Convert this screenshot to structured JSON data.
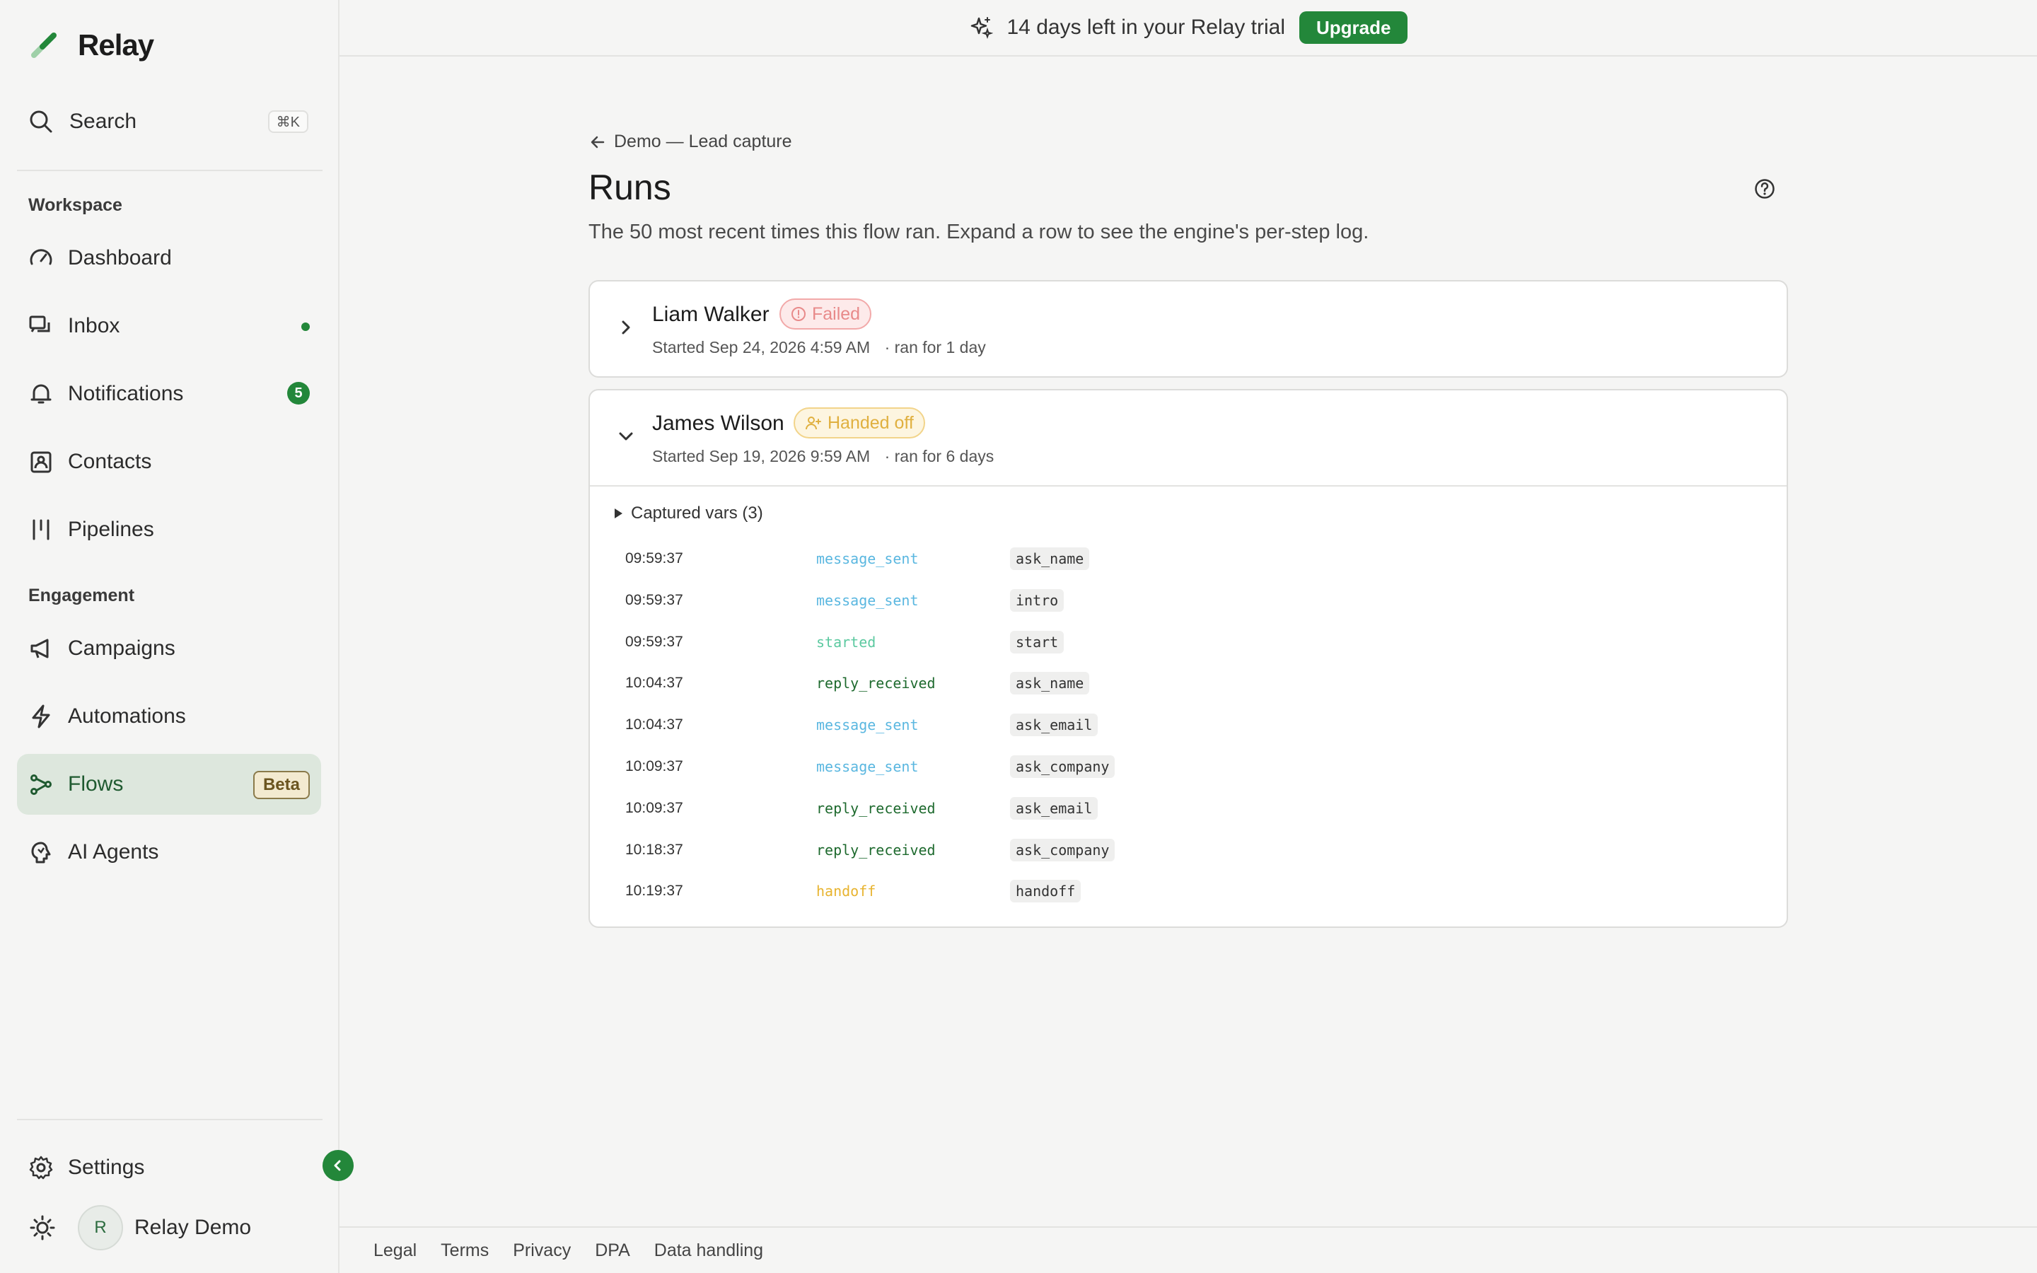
{
  "app": {
    "name": "Relay"
  },
  "sidebar": {
    "search": {
      "label": "Search",
      "shortcut": "⌘K"
    },
    "sections": {
      "workspace": "Workspace",
      "engagement": "Engagement"
    },
    "items": [
      {
        "label": "Dashboard",
        "icon": "dashboard-gauge-icon"
      },
      {
        "label": "Inbox",
        "icon": "inbox-chat-icon"
      },
      {
        "label": "Notifications",
        "icon": "bell-icon",
        "count": "5"
      },
      {
        "label": "Contacts",
        "icon": "contacts-icon"
      },
      {
        "label": "Pipelines",
        "icon": "pipelines-icon"
      },
      {
        "label": "Campaigns",
        "icon": "megaphone-icon"
      },
      {
        "label": "Automations",
        "icon": "lightning-icon"
      },
      {
        "label": "Flows",
        "icon": "flows-icon",
        "badge": "Beta"
      },
      {
        "label": "AI Agents",
        "icon": "ai-brain-icon"
      }
    ],
    "settings": "Settings",
    "user": {
      "initial": "R",
      "name": "Relay Demo"
    }
  },
  "topbar": {
    "trial_text": "14 days left in your Relay trial",
    "upgrade_label": "Upgrade"
  },
  "main": {
    "breadcrumb": "Demo — Lead capture",
    "title": "Runs",
    "subtitle": "The 50 most recent times this flow ran. Expand a row to see the engine's per-step log.",
    "runs": [
      {
        "name": "Liam Walker",
        "status": "Failed",
        "started": "Started Sep 24, 2026 4:59 AM",
        "duration": "· ran for 1 day"
      },
      {
        "name": "James Wilson",
        "status": "Handed off",
        "started": "Started Sep 19, 2026 9:59 AM",
        "duration": "· ran for 6 days",
        "captured_vars": "Captured vars (3)",
        "log": [
          {
            "time": "09:59:37",
            "event": "message_sent",
            "node": "ask_name"
          },
          {
            "time": "09:59:37",
            "event": "message_sent",
            "node": "intro"
          },
          {
            "time": "09:59:37",
            "event": "started",
            "node": "start"
          },
          {
            "time": "10:04:37",
            "event": "reply_received",
            "node": "ask_name"
          },
          {
            "time": "10:04:37",
            "event": "message_sent",
            "node": "ask_email"
          },
          {
            "time": "10:09:37",
            "event": "message_sent",
            "node": "ask_company"
          },
          {
            "time": "10:09:37",
            "event": "reply_received",
            "node": "ask_email"
          },
          {
            "time": "10:18:37",
            "event": "reply_received",
            "node": "ask_company"
          },
          {
            "time": "10:19:37",
            "event": "handoff",
            "node": "handoff"
          }
        ]
      }
    ]
  },
  "footer": {
    "links": [
      "Legal",
      "Terms",
      "Privacy",
      "DPA",
      "Data handling"
    ]
  },
  "colors": {
    "accent": "#23873a",
    "failed": "#e88a8a",
    "handed_off": "#e0b040",
    "message_sent": "#5ab7e0",
    "started": "#5cc9a0",
    "reply_received": "#1e6a2e",
    "handoff": "#e8b430"
  }
}
